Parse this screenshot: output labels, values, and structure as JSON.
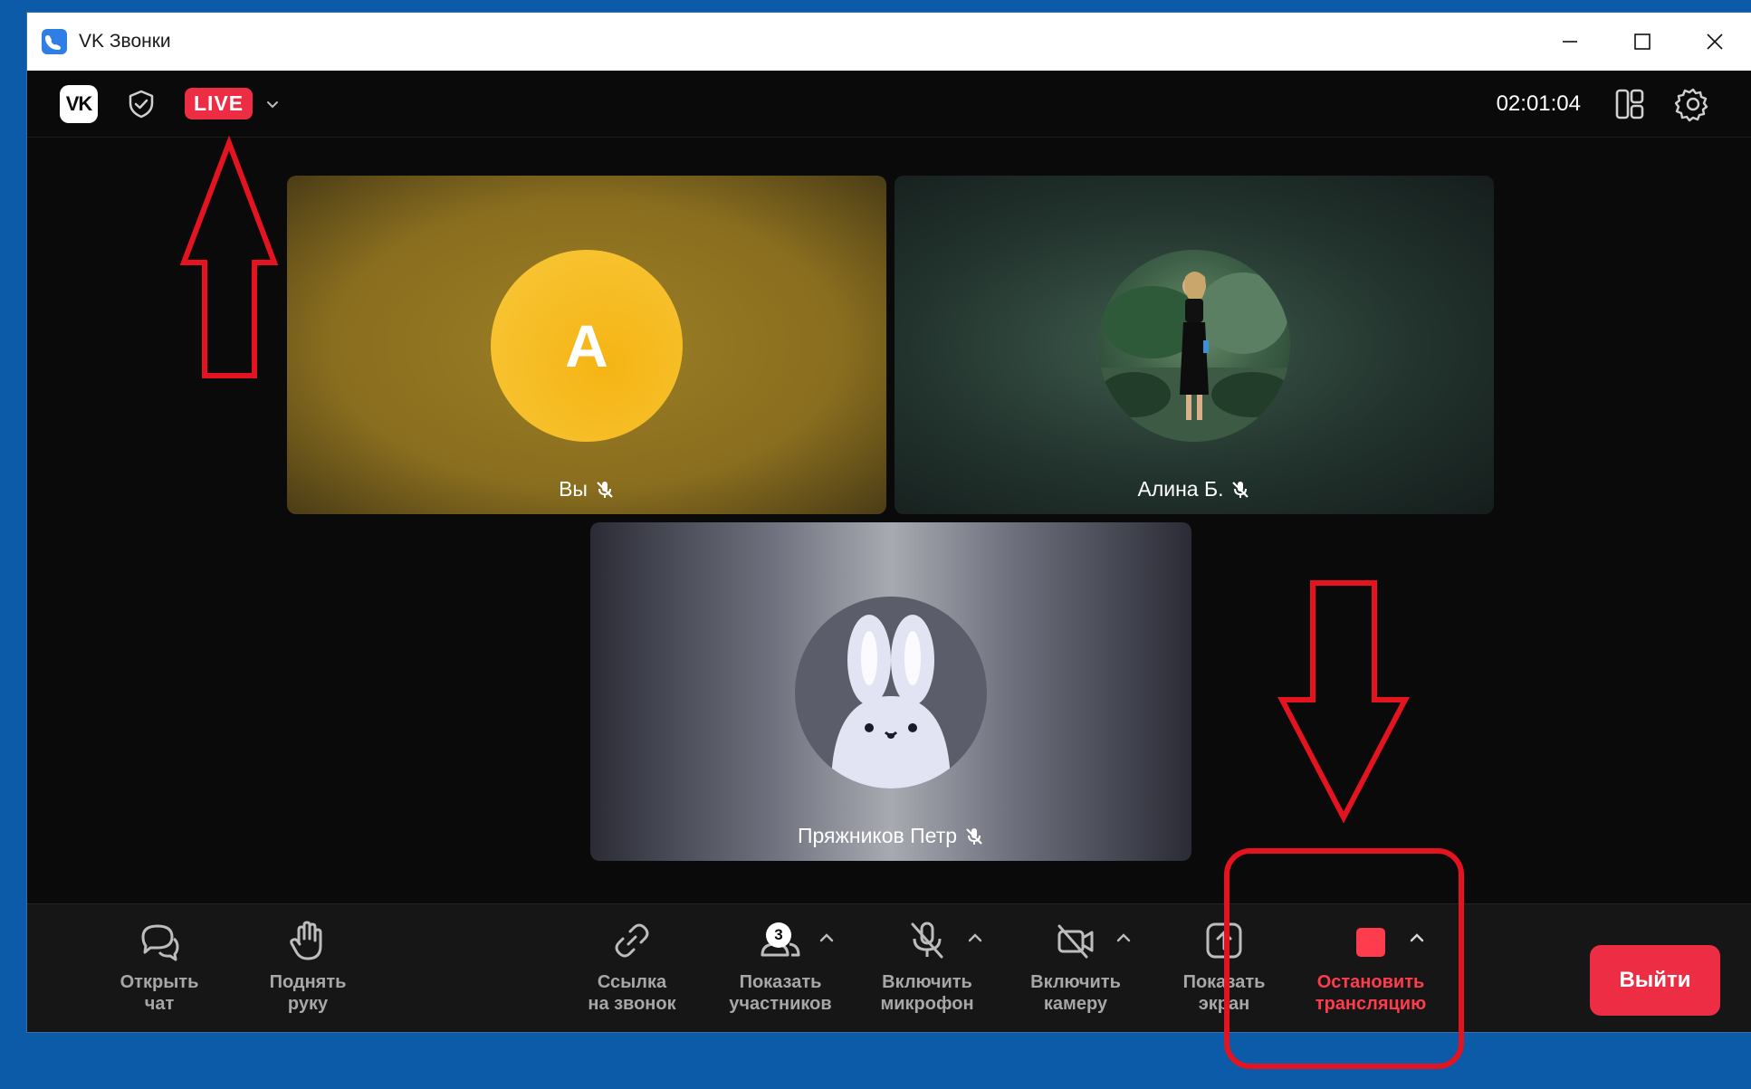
{
  "window": {
    "title": "VK Звонки"
  },
  "topbar": {
    "logo_text": "VK",
    "live_label": "LIVE",
    "timer": "02:01:04"
  },
  "participants": [
    {
      "name": "Вы",
      "avatar_letter": "A",
      "muted": true
    },
    {
      "name": "Алина Б.",
      "muted": true
    },
    {
      "name": "Пряжников Петр",
      "muted": true
    }
  ],
  "toolbar": {
    "open_chat": "Открыть\nчат",
    "raise_hand": "Поднять\nруку",
    "call_link": "Ссылка\nна звонок",
    "show_participants": "Показать\nучастников",
    "participants_count": "3",
    "enable_mic": "Включить\nмикрофон",
    "enable_camera": "Включить\nкамеру",
    "share_screen": "Показать\nэкран",
    "stop_stream": "Остановить\nтрансляцию",
    "exit": "Выйти"
  },
  "colors": {
    "live_red": "#ed2d43",
    "annotation_red": "#e3141f",
    "desktop_blue": "#0b5ba8"
  }
}
